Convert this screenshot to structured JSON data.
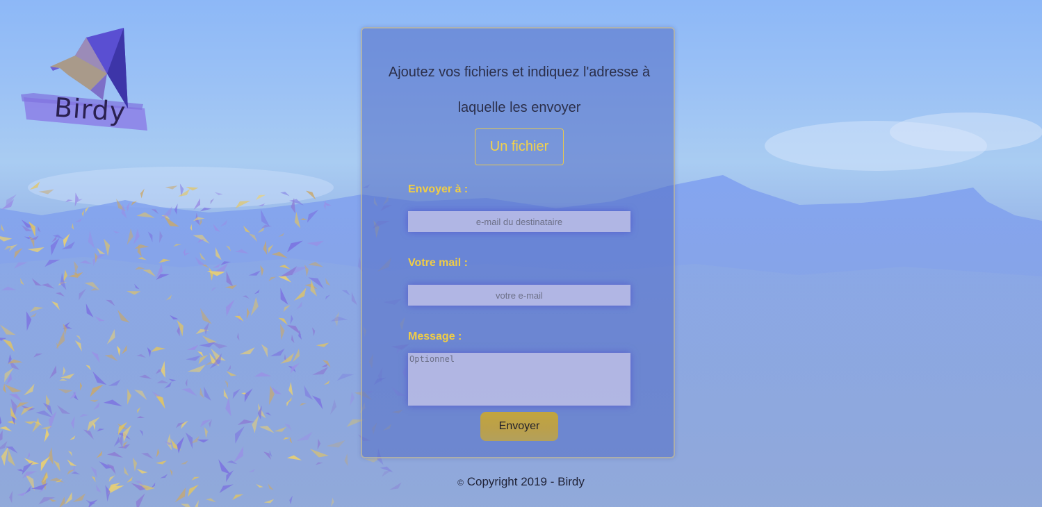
{
  "brand": {
    "name": "Birdy"
  },
  "form": {
    "title": "Ajoutez vos fichiers et indiquez l'adresse à laquelle les envoyer",
    "file_button_label": "Un fichier",
    "recipient": {
      "label": "Envoyer à :",
      "placeholder": "e-mail du destinataire",
      "value": ""
    },
    "sender": {
      "label": "Votre mail :",
      "placeholder": "votre e-mail",
      "value": ""
    },
    "message": {
      "label": "Message :",
      "placeholder": "Optionnel",
      "value": ""
    },
    "submit_label": "Envoyer"
  },
  "footer": {
    "copyright_symbol": "©",
    "text": "Copyright 2019 - Birdy"
  },
  "colors": {
    "accent_gold": "#f0cd45",
    "card_blue": "#526cc4",
    "sky_blue": "#9cc2f5",
    "origami_purple": "#6b5fd6"
  },
  "icons": {
    "logo": "origami-bird-icon",
    "background": "origami-flock-background"
  }
}
